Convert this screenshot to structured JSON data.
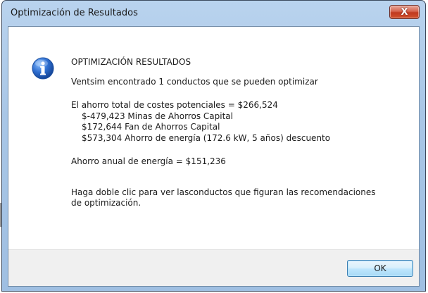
{
  "window": {
    "title": "Optimización de Resultados",
    "close_label": "X"
  },
  "message": {
    "heading": "OPTIMIZACIÓN RESULTADOS",
    "line1": "Ventsim encontrado 1 conductos que se pueden optimizar",
    "savings_total": "El ahorro total de costes potenciales =  $266,524",
    "detail1": "$-479,423 Minas de Ahorros Capital",
    "detail2": "$172,644 Fan de Ahorros Capital",
    "detail3": "$573,304 Ahorro de energía (172.6 kW, 5 años) descuento",
    "annual": "Ahorro anual de energía =  $151,236",
    "hint1": "Haga doble clic para ver lasconductos que figuran las recomendaciones",
    "hint2": "de optimización."
  },
  "buttons": {
    "ok_label": "OK"
  },
  "icons": {
    "message_icon": "info-icon",
    "accent": "#2f6fd1"
  }
}
